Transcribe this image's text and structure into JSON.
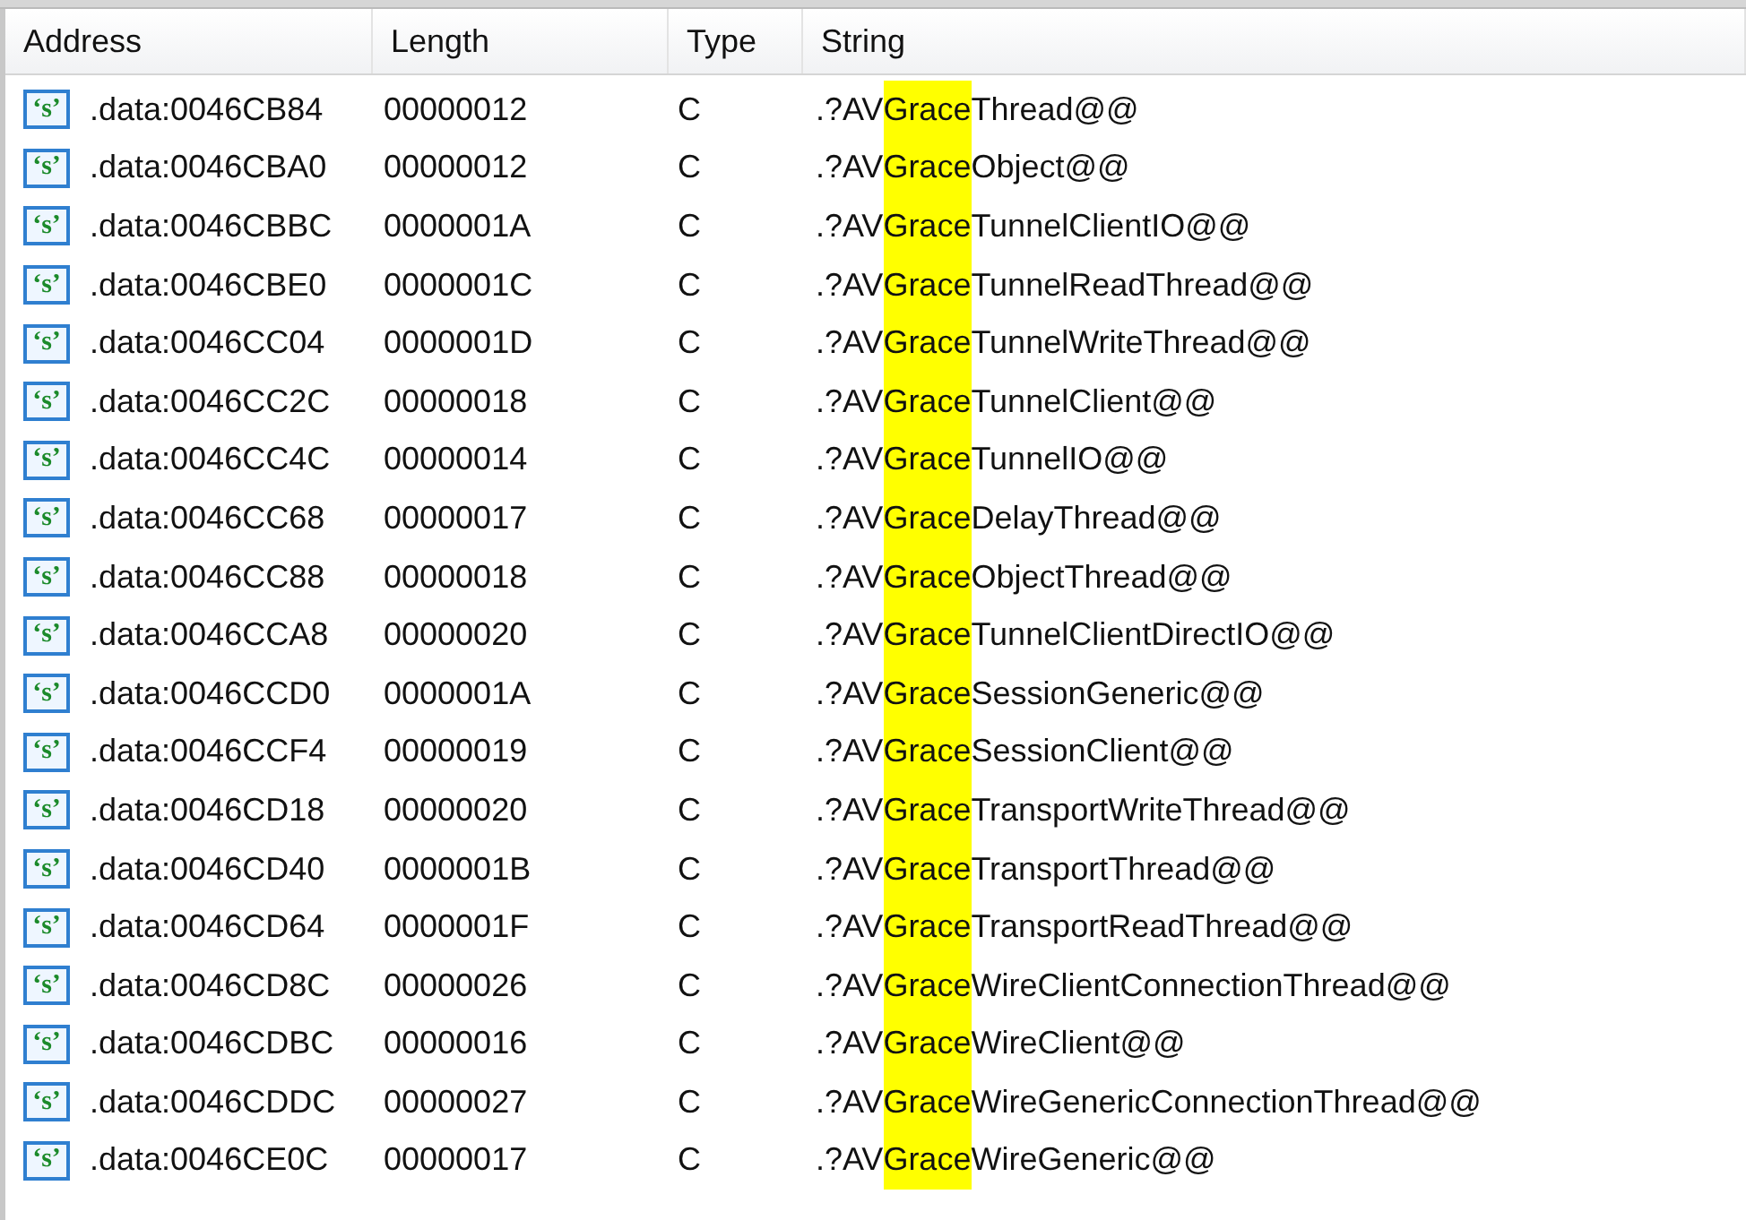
{
  "columns": [
    "Address",
    "Length",
    "Type",
    "String"
  ],
  "rows": [
    {
      "icon": "‘s’",
      "address": ".data:0046CB84",
      "length": "00000012",
      "type": "C",
      "string": {
        "before": ".?AV",
        "match": "Grace",
        "after": "Thread@@"
      }
    },
    {
      "icon": "‘s’",
      "address": ".data:0046CBA0",
      "length": "00000012",
      "type": "C",
      "string": {
        "before": ".?AV",
        "match": "Grace",
        "after": "Object@@"
      }
    },
    {
      "icon": "‘s’",
      "address": ".data:0046CBBC",
      "length": "0000001A",
      "type": "C",
      "string": {
        "before": ".?AV",
        "match": "Grace",
        "after": "TunnelClientIO@@"
      }
    },
    {
      "icon": "‘s’",
      "address": ".data:0046CBE0",
      "length": "0000001C",
      "type": "C",
      "string": {
        "before": ".?AV",
        "match": "Grace",
        "after": "TunnelReadThread@@"
      }
    },
    {
      "icon": "‘s’",
      "address": ".data:0046CC04",
      "length": "0000001D",
      "type": "C",
      "string": {
        "before": ".?AV",
        "match": "Grace",
        "after": "TunnelWriteThread@@"
      }
    },
    {
      "icon": "‘s’",
      "address": ".data:0046CC2C",
      "length": "00000018",
      "type": "C",
      "string": {
        "before": ".?AV",
        "match": "Grace",
        "after": "TunnelClient@@"
      }
    },
    {
      "icon": "‘s’",
      "address": ".data:0046CC4C",
      "length": "00000014",
      "type": "C",
      "string": {
        "before": ".?AV",
        "match": "Grace",
        "after": "TunnelIO@@"
      }
    },
    {
      "icon": "‘s’",
      "address": ".data:0046CC68",
      "length": "00000017",
      "type": "C",
      "string": {
        "before": ".?AV",
        "match": "Grace",
        "after": "DelayThread@@"
      }
    },
    {
      "icon": "‘s’",
      "address": ".data:0046CC88",
      "length": "00000018",
      "type": "C",
      "string": {
        "before": ".?AV",
        "match": "Grace",
        "after": "ObjectThread@@"
      }
    },
    {
      "icon": "‘s’",
      "address": ".data:0046CCA8",
      "length": "00000020",
      "type": "C",
      "string": {
        "before": ".?AV",
        "match": "Grace",
        "after": "TunnelClientDirectIO@@"
      }
    },
    {
      "icon": "‘s’",
      "address": ".data:0046CCD0",
      "length": "0000001A",
      "type": "C",
      "string": {
        "before": ".?AV",
        "match": "Grace",
        "after": "SessionGeneric@@"
      }
    },
    {
      "icon": "‘s’",
      "address": ".data:0046CCF4",
      "length": "00000019",
      "type": "C",
      "string": {
        "before": ".?AV",
        "match": "Grace",
        "after": "SessionClient@@"
      }
    },
    {
      "icon": "‘s’",
      "address": ".data:0046CD18",
      "length": "00000020",
      "type": "C",
      "string": {
        "before": ".?AV",
        "match": "Grace",
        "after": "TransportWriteThread@@"
      }
    },
    {
      "icon": "‘s’",
      "address": ".data:0046CD40",
      "length": "0000001B",
      "type": "C",
      "string": {
        "before": ".?AV",
        "match": "Grace",
        "after": "TransportThread@@"
      }
    },
    {
      "icon": "‘s’",
      "address": ".data:0046CD64",
      "length": "0000001F",
      "type": "C",
      "string": {
        "before": ".?AV",
        "match": "Grace",
        "after": "TransportReadThread@@"
      }
    },
    {
      "icon": "‘s’",
      "address": ".data:0046CD8C",
      "length": "00000026",
      "type": "C",
      "string": {
        "before": ".?AV",
        "match": "Grace",
        "after": "WireClientConnectionThread@@"
      }
    },
    {
      "icon": "‘s’",
      "address": ".data:0046CDBC",
      "length": "00000016",
      "type": "C",
      "string": {
        "before": ".?AV",
        "match": "Grace",
        "after": "WireClient@@"
      }
    },
    {
      "icon": "‘s’",
      "address": ".data:0046CDDC",
      "length": "00000027",
      "type": "C",
      "string": {
        "before": ".?AV",
        "match": "Grace",
        "after": "WireGenericConnectionThread@@"
      }
    },
    {
      "icon": "‘s’",
      "address": ".data:0046CE0C",
      "length": "00000017",
      "type": "C",
      "string": {
        "before": ".?AV",
        "match": "Grace",
        "after": "WireGeneric@@"
      }
    }
  ]
}
